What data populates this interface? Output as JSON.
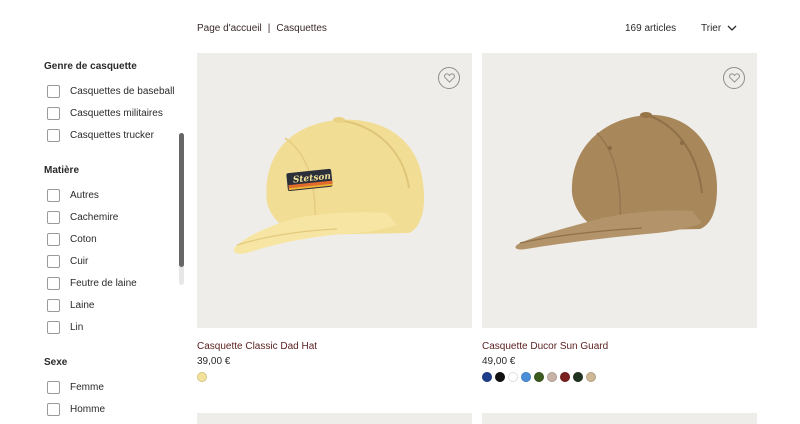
{
  "breadcrumb": {
    "home": "Page d'accueil",
    "separator": "|",
    "current": "Casquettes"
  },
  "results": {
    "count": "169 articles",
    "sort_label": "Trier"
  },
  "filters": {
    "genre": {
      "title": "Genre de casquette",
      "options": [
        "Casquettes de baseball",
        "Casquettes militaires",
        "Casquettes trucker"
      ]
    },
    "matiere": {
      "title": "Matière",
      "options": [
        "Autres",
        "Cachemire",
        "Coton",
        "Cuir",
        "Feutre de laine",
        "Laine",
        "Lin"
      ]
    },
    "sexe": {
      "title": "Sexe",
      "options": [
        "Femme",
        "Homme"
      ]
    }
  },
  "products": [
    {
      "name": "Casquette Classic Dad Hat",
      "price": "39,00 €",
      "logo_text": "Stetson",
      "colors": [
        "#f3e29a"
      ]
    },
    {
      "name": "Casquette Ducor Sun Guard",
      "price": "49,00 €",
      "colors": [
        "#1d3e8c",
        "#111111",
        "#ffffff",
        "#4a8fd8",
        "#3d5a1f",
        "#c8b3a8",
        "#7a1f1f",
        "#1f3320",
        "#cdb896"
      ]
    }
  ]
}
